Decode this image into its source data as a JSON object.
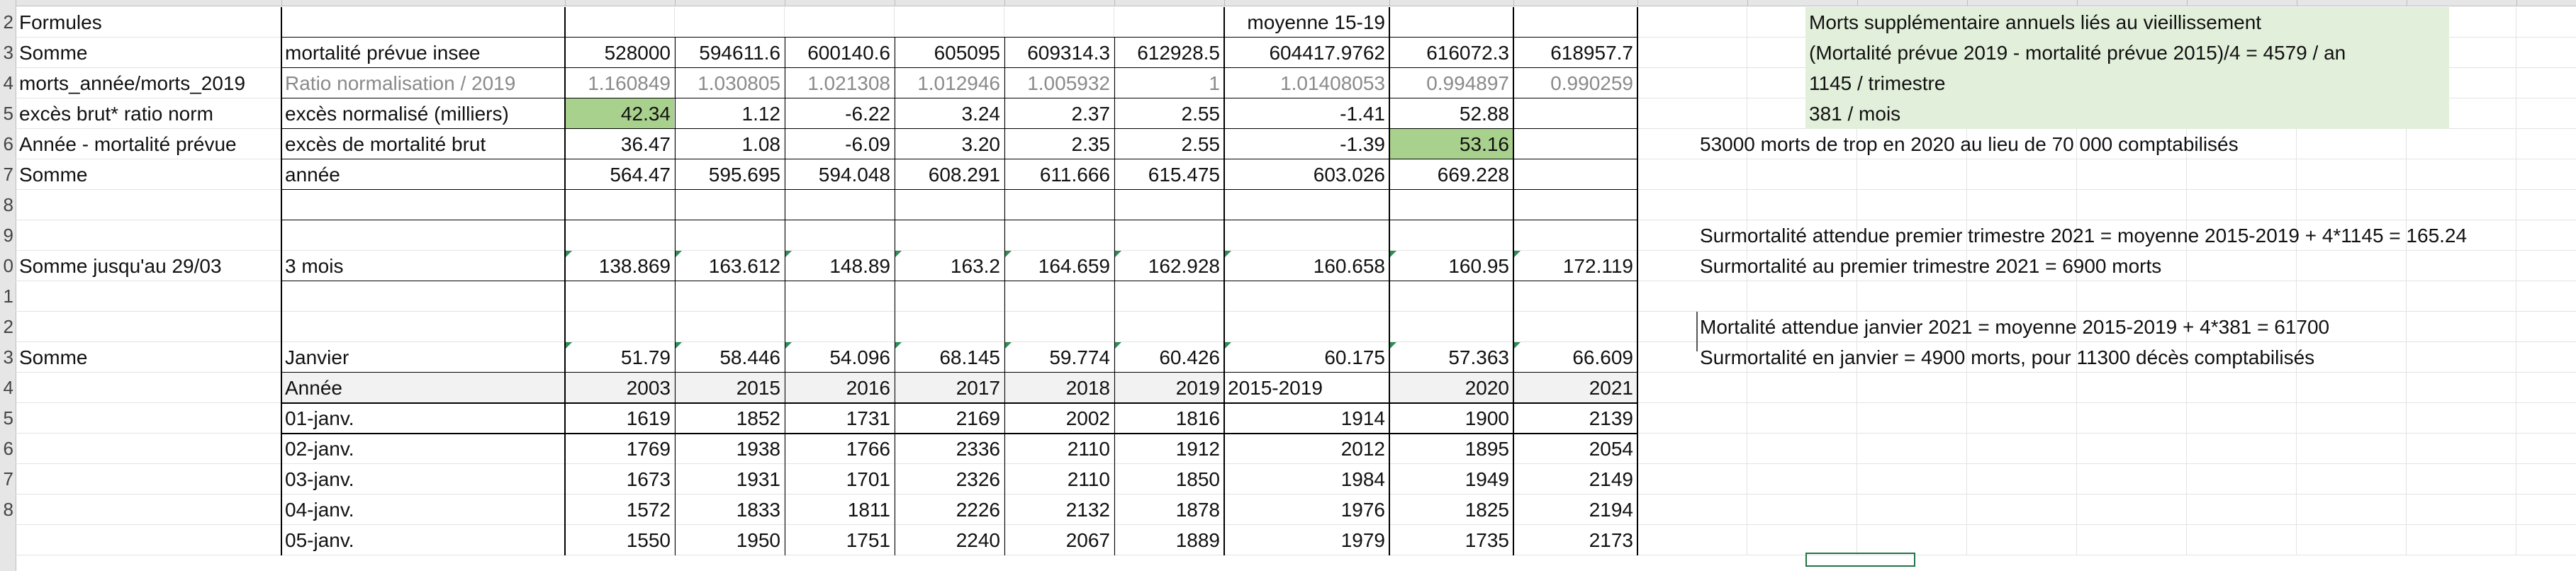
{
  "sheet": {
    "row_numbers": [
      "2",
      "3",
      "4",
      "5",
      "6",
      "7",
      "8",
      "9",
      "0",
      "1",
      "2",
      "3",
      "4",
      "5",
      "6",
      "7",
      "8"
    ],
    "rows": [
      [
        "Formules",
        "",
        "",
        "",
        "",
        "",
        "",
        "",
        "moyenne 15-19",
        "",
        ""
      ],
      [
        "Somme",
        "mortalité prévue insee",
        "528000",
        "594611.6",
        "600140.6",
        "605095",
        "609314.3",
        "612928.5",
        "604417.9762",
        "616072.3",
        "618957.7"
      ],
      [
        "morts_année/morts_2019",
        "Ratio normalisation / 2019",
        "1.160849",
        "1.030805",
        "1.021308",
        "1.012946",
        "1.005932",
        "1",
        "1.01408053",
        "0.994897",
        "0.990259"
      ],
      [
        "excès brut* ratio norm",
        "excès normalisé (milliers)",
        "42.34",
        "1.12",
        "-6.22",
        "3.24",
        "2.37",
        "2.55",
        "-1.41",
        "52.88",
        ""
      ],
      [
        "Année - mortalité prévue",
        "excès de mortalité brut",
        "36.47",
        "1.08",
        "-6.09",
        "3.20",
        "2.35",
        "2.55",
        "-1.39",
        "53.16",
        ""
      ],
      [
        "Somme",
        "année",
        "564.47",
        "595.695",
        "594.048",
        "608.291",
        "611.666",
        "615.475",
        "603.026",
        "669.228",
        ""
      ],
      [
        "",
        "",
        "",
        "",
        "",
        "",
        "",
        "",
        "",
        "",
        ""
      ],
      [
        "",
        "",
        "",
        "",
        "",
        "",
        "",
        "",
        "",
        "",
        ""
      ],
      [
        "Somme jusqu'au 29/03",
        "3 mois",
        "138.869",
        "163.612",
        "148.89",
        "163.2",
        "164.659",
        "162.928",
        "160.658",
        "160.95",
        "172.119"
      ],
      [
        "",
        "",
        "",
        "",
        "",
        "",
        "",
        "",
        "",
        "",
        ""
      ],
      [
        "",
        "",
        "",
        "",
        "",
        "",
        "",
        "",
        "",
        "",
        ""
      ],
      [
        "Somme",
        "Janvier",
        "51.79",
        "58.446",
        "54.096",
        "68.145",
        "59.774",
        "60.426",
        "60.175",
        "57.363",
        "66.609"
      ],
      [
        "",
        "Année",
        "2003",
        "2015",
        "2016",
        "2017",
        "2018",
        "2019",
        "2015-2019",
        "2020",
        "2021"
      ],
      [
        "",
        "01-janv.",
        "1619",
        "1852",
        "1731",
        "2169",
        "2002",
        "1816",
        "1914",
        "1900",
        "2139"
      ],
      [
        "",
        "02-janv.",
        "1769",
        "1938",
        "1766",
        "2336",
        "2110",
        "1912",
        "2012",
        "1895",
        "2054"
      ],
      [
        "",
        "03-janv.",
        "1673",
        "1931",
        "1701",
        "2326",
        "2110",
        "1850",
        "1984",
        "1949",
        "2149"
      ],
      [
        "",
        "04-janv.",
        "1572",
        "1833",
        "1811",
        "2226",
        "2132",
        "1878",
        "1976",
        "1825",
        "2194"
      ],
      [
        "",
        "05-janv.",
        "1550",
        "1950",
        "1751",
        "2240",
        "2067",
        "1889",
        "1979",
        "1735",
        "2173"
      ]
    ],
    "notes": {
      "green_box": [
        "Morts supplémentaire annuels liés au vieillissement",
        "(Mortalité prévue 2019 - mortalité prévue 2015)/4 = 4579 / an",
        "1145 / trimestre",
        "381 / mois"
      ],
      "excess_2020": "53000 morts de trop en 2020 au lieu de 70 000 comptabilisés",
      "expected_q1_2021": "Surmortalité attendue premier trimestre 2021 = moyenne 2015-2019 + 4*1145 = 165.24",
      "excess_q1_2021": "Surmortalité au premier trimestre 2021 = 6900 morts",
      "expected_jan_2021": "Mortalité attendue janvier 2021 = moyenne 2015-2019 + 4*381 = 61700",
      "excess_jan_2021": "Surmortalité en janvier = 4900 morts, pour 11300 décès comptabilisés"
    }
  }
}
